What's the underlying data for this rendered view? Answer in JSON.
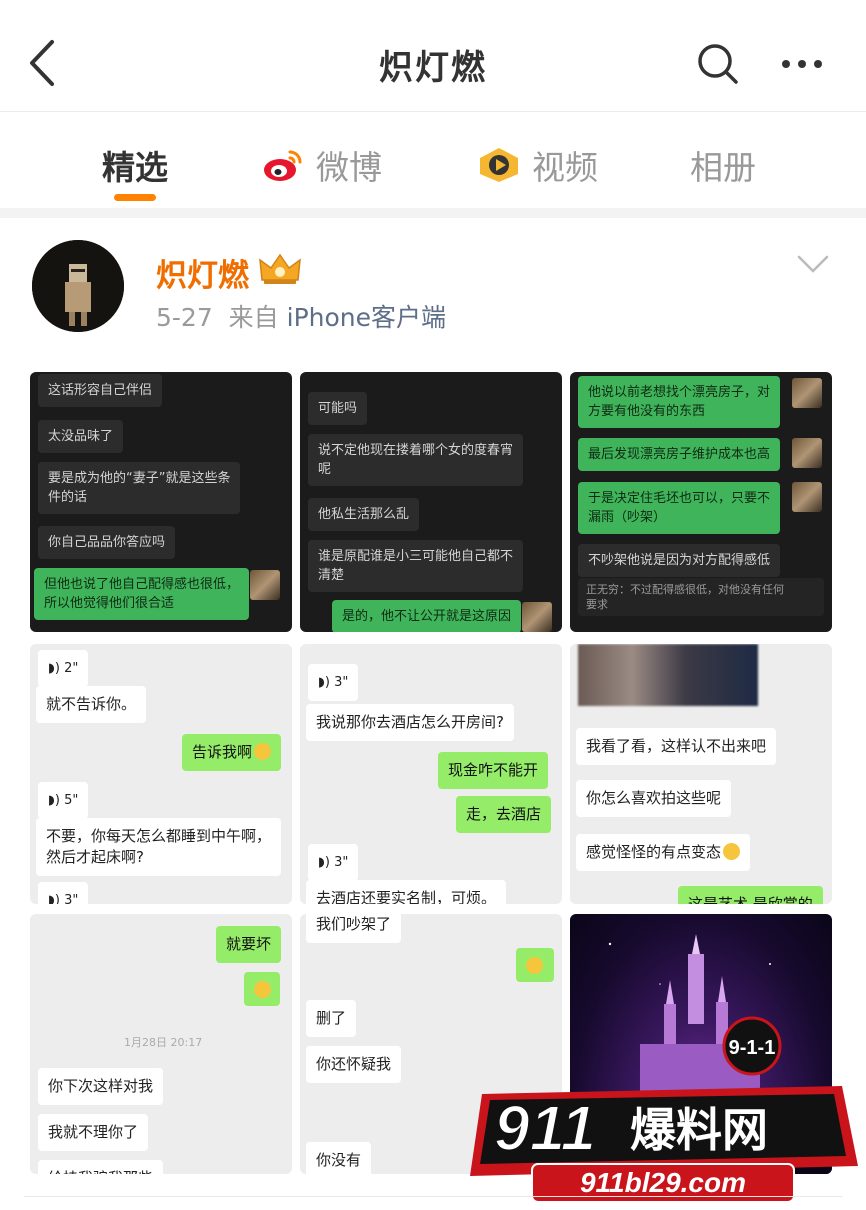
{
  "header": {
    "title": "炽灯燃",
    "back_icon": "back-arrow-icon",
    "search_icon": "search-icon",
    "more_icon": "more-icon"
  },
  "tabs": [
    {
      "label": "精选",
      "active": true
    },
    {
      "label": "微博",
      "icon": "weibo-icon"
    },
    {
      "label": "视频",
      "icon": "video-icon"
    },
    {
      "label": "相册"
    }
  ],
  "post": {
    "author": "炽灯燃",
    "date": "5-27",
    "source_prefix": "来自",
    "source": "iPhone客户端"
  },
  "tiles": {
    "t1": {
      "b1": "这话形容自己伴侣",
      "b2": "太没品味了",
      "b3": "要是成为他的“妻子”就是这些条\n件的话",
      "b4": "你自己品品你答应吗",
      "b5": "但他也说了他自己配得感也很低，\n所以他觉得他们很合适"
    },
    "t2": {
      "b1": "可能吗",
      "b2": "说不定他现在搂着哪个女的度春宵\n呢",
      "b3": "他私生活那么乱",
      "b4": "谁是原配谁是小三可能他自己都不\n清楚",
      "b5": "是的，他不让公开就是这原因"
    },
    "t3": {
      "b1": "他说以前老想找个漂亮房子，对\n方要有他没有的东西",
      "b2": "最后发现漂亮房子维护成本也高",
      "b3": "于是决定住毛坯也可以，只要不\n漏雨（吵架）",
      "b4": "不吵架他说是因为对方配得感低",
      "note": "正无穷：不过配得感很低，对他没有任何\n要求"
    },
    "t4": {
      "v1": "2\"",
      "b1": "就不告诉你。",
      "b2": "告诉我啊",
      "v2": "5\"",
      "b3": "不要，你每天怎么都睡到中午啊，\n然后才起床啊?",
      "v3": "3\""
    },
    "t5": {
      "v1": "3\"",
      "b1": "我说那你去酒店怎么开房间?",
      "b2": "现金咋不能开",
      "b3": "走，去酒店",
      "v2": "3\"",
      "b4": "去酒店还要实名制，可烦。"
    },
    "t6": {
      "b1": "我看了看，这样认不出来吧",
      "b2": "你怎么喜欢拍这些呢",
      "b3": "感觉怪怪的有点变态",
      "b4": "这是艺术 是欣赏的"
    },
    "t7": {
      "b1": "就要坏",
      "time": "1月28日 20:17",
      "b2": "你下次这样对我",
      "b3": "我就不理你了",
      "b4": "给挂我骗我那些"
    },
    "t8": {
      "b1": "我们吵架了",
      "b2": "删了",
      "b3": "你还怀疑我",
      "b4": "你没有"
    }
  },
  "watermark": {
    "badge": "9-1-1",
    "brand_number": "911",
    "brand_text": "爆料网",
    "url": "911bl29.com"
  },
  "colors": {
    "accent": "#ff8200",
    "author": "#f06d00",
    "wechat_green": "#95ec69"
  }
}
